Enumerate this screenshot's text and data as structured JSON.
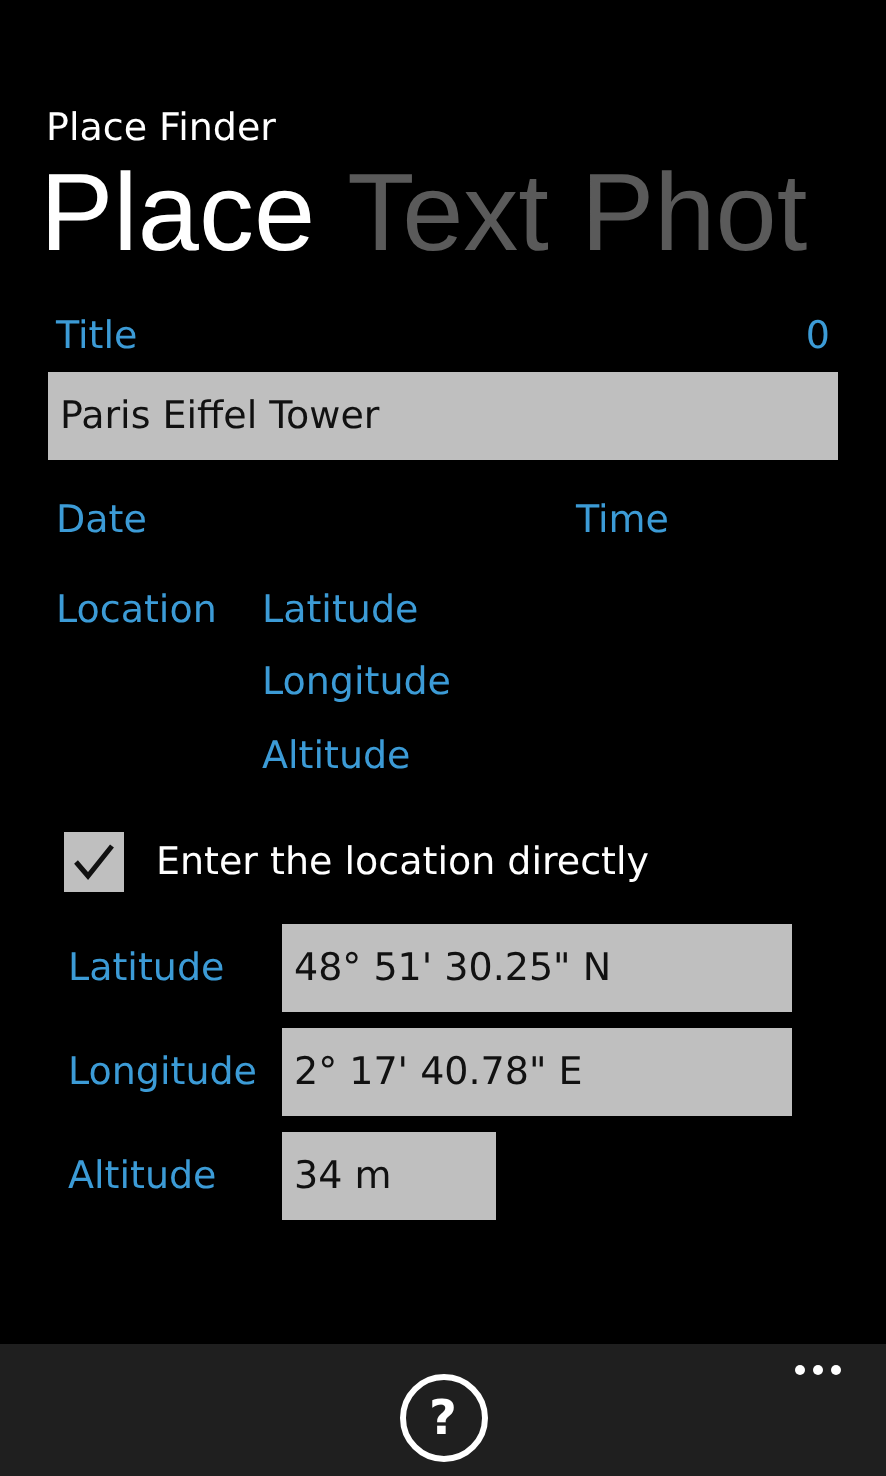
{
  "app_title": "Place Finder",
  "pivot": [
    {
      "label": "Place",
      "selected": true
    },
    {
      "label": "Text",
      "selected": false
    },
    {
      "label": "Phot",
      "selected": false
    }
  ],
  "title_field": {
    "label": "Title",
    "count": "0",
    "value": "Paris Eiffel Tower"
  },
  "date_label": "Date",
  "time_label": "Time",
  "location": {
    "label": "Location",
    "parts": [
      "Latitude",
      "Longitude",
      "Altitude"
    ]
  },
  "direct_checkbox": {
    "label": "Enter the location directly",
    "checked": true
  },
  "coordinate_fields": [
    {
      "label": "Latitude",
      "value": "48° 51' 30.25\" N",
      "kind": "wide"
    },
    {
      "label": "Longitude",
      "value": "2° 17' 40.78\" E",
      "kind": "wide"
    },
    {
      "label": "Altitude",
      "value": "34 m",
      "kind": "short"
    }
  ],
  "app_bar": {
    "help_glyph": "?"
  }
}
